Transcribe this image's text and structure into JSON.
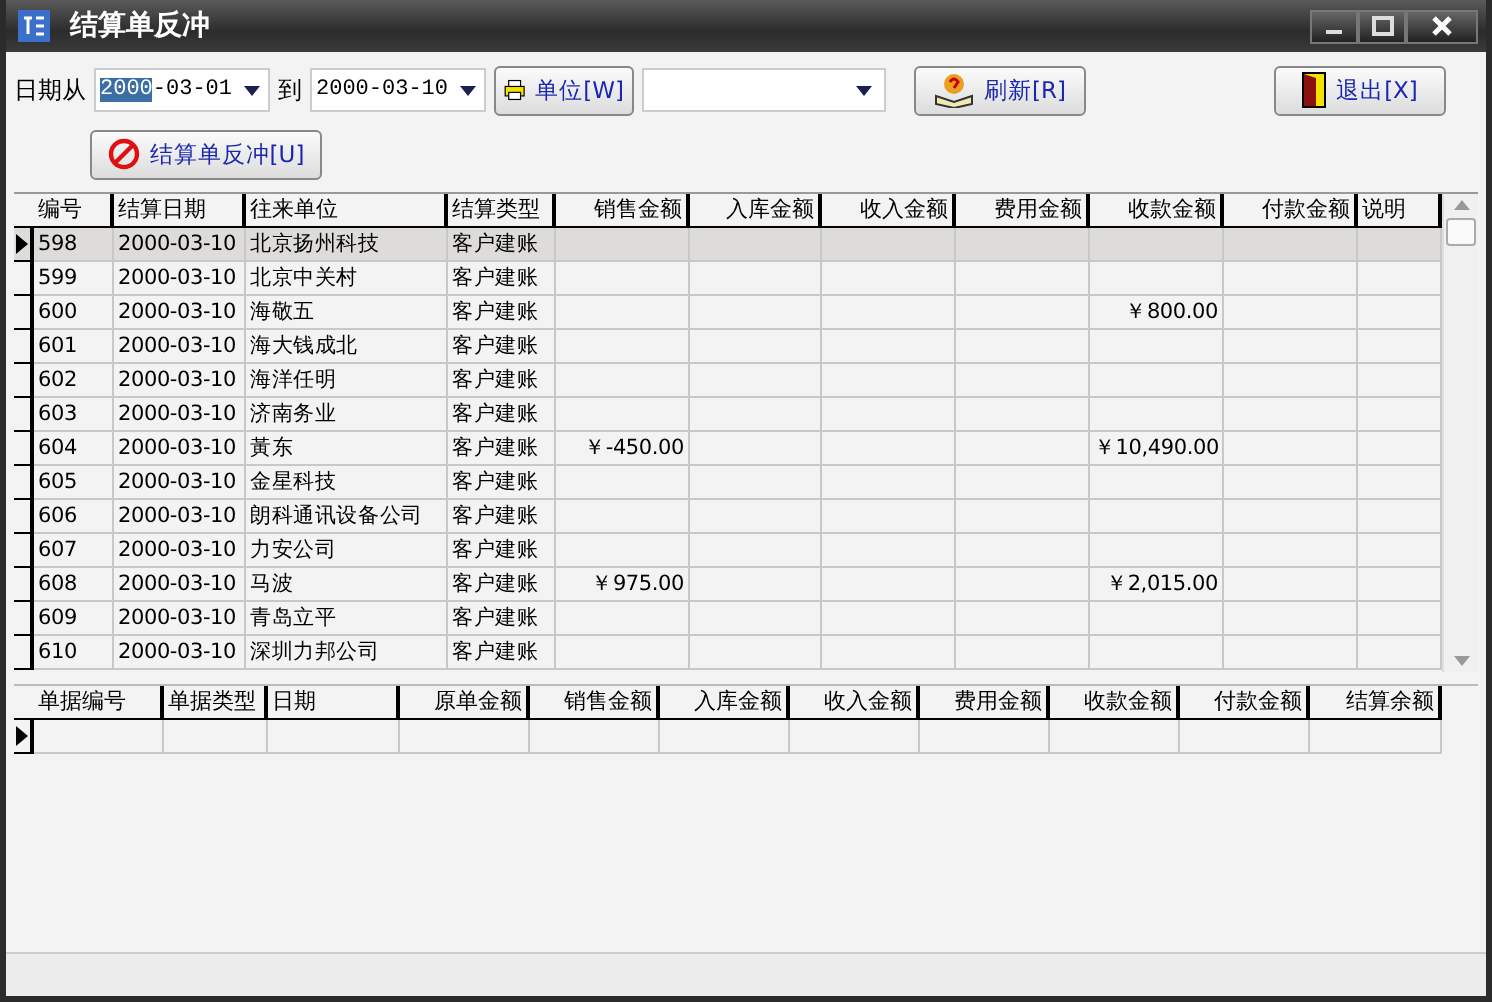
{
  "window": {
    "title": "结算单反冲"
  },
  "filters": {
    "date_from_label": "日期从",
    "date_from": {
      "selected_part": "2000",
      "rest": "-03-01"
    },
    "date_to_label": "到",
    "date_to": "2000-03-10",
    "unit_button": "单位[W]",
    "refresh_button": "刷新[R]",
    "exit_button": "退出[X]"
  },
  "reverse_button": "结算单反冲[U]",
  "main_table": {
    "columns": [
      {
        "label": "编号"
      },
      {
        "label": "结算日期"
      },
      {
        "label": "往来单位"
      },
      {
        "label": "结算类型"
      },
      {
        "label": "销售金额"
      },
      {
        "label": "入库金额"
      },
      {
        "label": "收入金额"
      },
      {
        "label": "费用金额"
      },
      {
        "label": "收款金额"
      },
      {
        "label": "付款金额"
      },
      {
        "label": "说明"
      }
    ],
    "rows": [
      {
        "no": "598",
        "date": "2000-03-10",
        "partner": "北京扬州科技",
        "type": "客户建账",
        "selected": true
      },
      {
        "no": "599",
        "date": "2000-03-10",
        "partner": "北京中关村",
        "type": "客户建账",
        "selected": false
      },
      {
        "no": "600",
        "date": "2000-03-10",
        "partner": "海敬五",
        "type": "客户建账",
        "receipt": "￥800.00",
        "selected": false
      },
      {
        "no": "601",
        "date": "2000-03-10",
        "partner": "海大钱成北",
        "type": "客户建账",
        "selected": false
      },
      {
        "no": "602",
        "date": "2000-03-10",
        "partner": "海洋任明",
        "type": "客户建账",
        "selected": false
      },
      {
        "no": "603",
        "date": "2000-03-10",
        "partner": "济南务业",
        "type": "客户建账",
        "selected": false
      },
      {
        "no": "604",
        "date": "2000-03-10",
        "partner": "黃东",
        "type": "客户建账",
        "sales": "￥-450.00",
        "receipt": "￥10,490.00",
        "selected": false
      },
      {
        "no": "605",
        "date": "2000-03-10",
        "partner": "金星科技",
        "type": "客户建账",
        "selected": false
      },
      {
        "no": "606",
        "date": "2000-03-10",
        "partner": "朗科通讯设备公司",
        "type": "客户建账",
        "selected": false
      },
      {
        "no": "607",
        "date": "2000-03-10",
        "partner": "力安公司",
        "type": "客户建账",
        "selected": false
      },
      {
        "no": "608",
        "date": "2000-03-10",
        "partner": "马波",
        "type": "客户建账",
        "sales": "￥975.00",
        "receipt": "￥2,015.00",
        "selected": false
      },
      {
        "no": "609",
        "date": "2000-03-10",
        "partner": "青岛立平",
        "type": "客户建账",
        "selected": false
      },
      {
        "no": "610",
        "date": "2000-03-10",
        "partner": "深圳力邦公司",
        "type": "客户建账",
        "selected": false
      }
    ]
  },
  "detail_table": {
    "columns": [
      {
        "label": "单据编号"
      },
      {
        "label": "单据类型"
      },
      {
        "label": "日期"
      },
      {
        "label": "原单金额"
      },
      {
        "label": "销售金额"
      },
      {
        "label": "入库金额"
      },
      {
        "label": "收入金额"
      },
      {
        "label": "费用金额"
      },
      {
        "label": "收款金额"
      },
      {
        "label": "付款金额"
      },
      {
        "label": "结算余额"
      }
    ]
  }
}
